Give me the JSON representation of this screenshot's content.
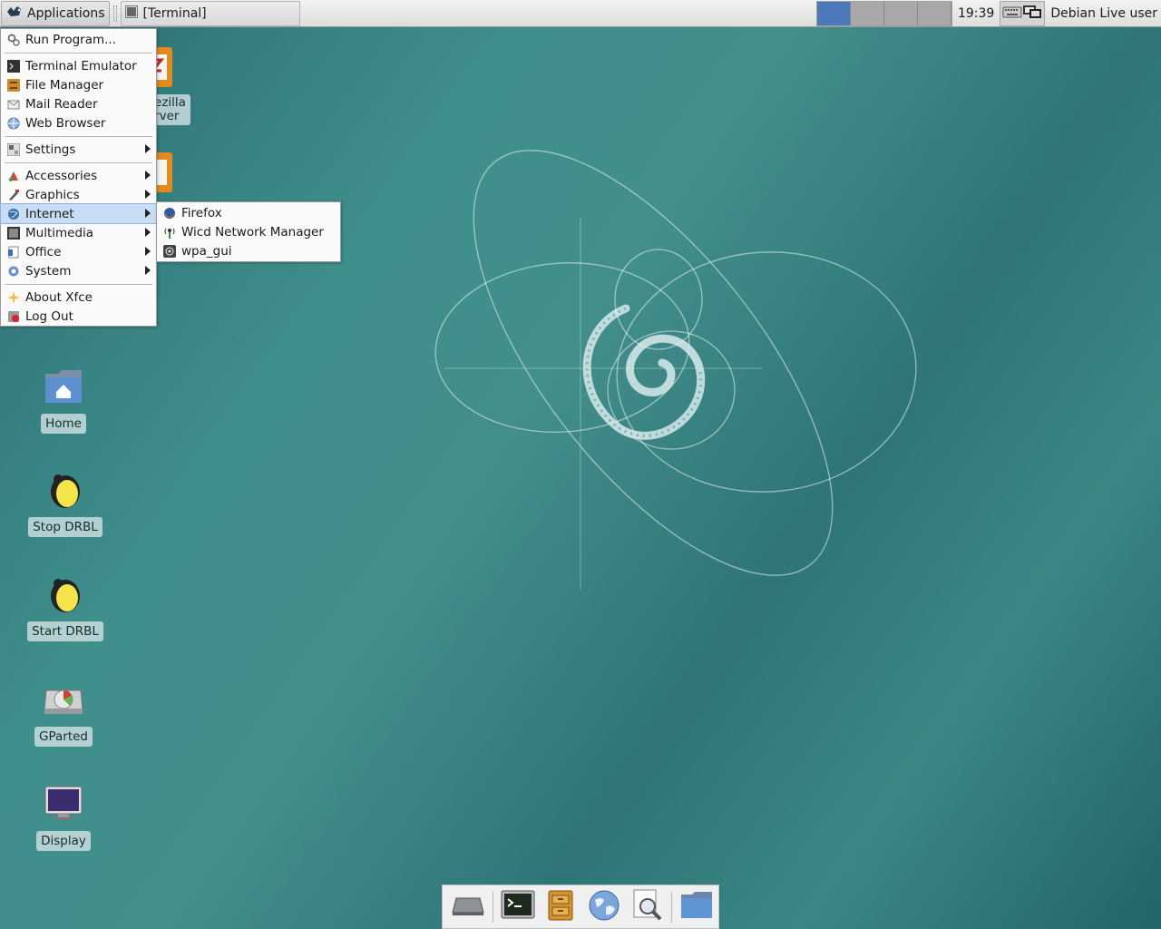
{
  "panel": {
    "apps_label": "Applications",
    "task_label": "[Terminal]",
    "workspaces": [
      "ws1",
      "ws2",
      "ws3",
      "ws4"
    ],
    "active_workspace": 1,
    "clock": "19:39",
    "user": "Debian Live user"
  },
  "menu": {
    "run": "Run Program...",
    "terminal": "Terminal Emulator",
    "files": "File Manager",
    "mail": "Mail Reader",
    "web": "Web Browser",
    "settings": "Settings",
    "accessories": "Accessories",
    "graphics": "Graphics",
    "internet": "Internet",
    "multimedia": "Multimedia",
    "office": "Office",
    "system": "System",
    "about": "About Xfce",
    "logout": "Log Out"
  },
  "submenu": {
    "firefox": "Firefox",
    "wicd": "Wicd Network Manager",
    "wpa": "wpa_gui"
  },
  "desktop": {
    "partial_line1": "ezilla",
    "partial_line2": "rver",
    "home": "Home",
    "stop_drbl": "Stop DRBL",
    "start_drbl": "Start DRBL",
    "gparted": "GParted",
    "display": "Display"
  },
  "colors": {
    "accent": "#4a78b8",
    "menu_highlight": "#c8dcf4",
    "wallpaper": "#3f8f8c"
  }
}
